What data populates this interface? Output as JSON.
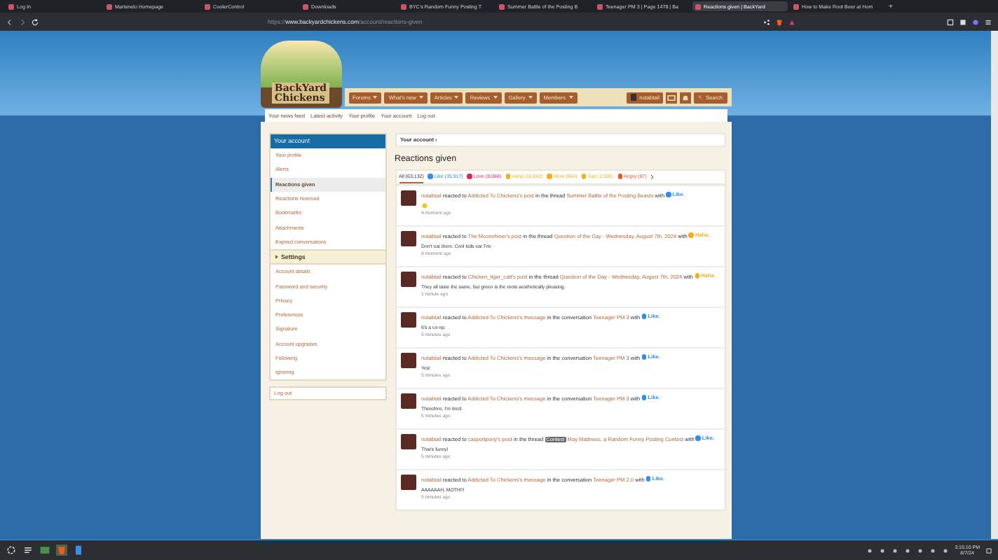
{
  "browser": {
    "tabs": [
      {
        "title": "Log In",
        "selected": false
      },
      {
        "title": "Martenelo Homepage",
        "selected": false
      },
      {
        "title": "CoolerControl",
        "selected": false
      },
      {
        "title": "Downloads",
        "selected": false
      },
      {
        "title": "BYC's Random Funny Posting T",
        "selected": false
      },
      {
        "title": "Summer Battle of the Posting B",
        "selected": false
      },
      {
        "title": "Teenager PM 3 | Page 1478 | Ba",
        "selected": false
      },
      {
        "title": "Reactions given | BackYard",
        "selected": true
      },
      {
        "title": "How to Make Root Beer at Hom",
        "selected": false
      }
    ],
    "new_tab": "+",
    "url_prefix": "https://",
    "url_host": "www.backyardchickens.com",
    "url_path": "/account/reactions-given"
  },
  "header": {
    "logo_line1": "BackYard",
    "logo_line2": "Chickens",
    "nav": [
      "Forums",
      "What's new",
      "Articles",
      "Reviews",
      "Gallery",
      "Members"
    ],
    "user": "notabtail",
    "search": "Search"
  },
  "subnav": [
    "Your news feed",
    "Latest activity",
    "Your profile",
    "Your account",
    "Log out"
  ],
  "sidebar": {
    "title": "Your account",
    "items": [
      {
        "label": "Your profile",
        "selected": false
      },
      {
        "label": "Alerts",
        "selected": false
      },
      {
        "label": "Reactions given",
        "selected": true
      },
      {
        "label": "Reactions received",
        "selected": false
      },
      {
        "label": "Bookmarks",
        "selected": false
      },
      {
        "label": "Attachments",
        "selected": false
      },
      {
        "label": "Expired conversations",
        "selected": false
      }
    ],
    "settings_title": "Settings",
    "settings_items": [
      {
        "label": "Account details",
        "selected": false
      },
      {
        "label": "Password and security",
        "selected": false
      },
      {
        "label": "Privacy",
        "selected": false
      },
      {
        "label": "Preferences",
        "selected": false
      },
      {
        "label": "Signature",
        "selected": false
      },
      {
        "label": "Account upgrades",
        "selected": false
      },
      {
        "label": "Following",
        "selected": false
      },
      {
        "label": "Ignoring",
        "selected": false
      }
    ],
    "logout": "Log out"
  },
  "breadcrumb": "Your account",
  "breadcrumb_caret": "›",
  "title": "Reactions given",
  "filters": [
    {
      "label": "All (63,132)",
      "selected": true
    },
    {
      "label": "Like (35,917)",
      "selected": false,
      "color": "#2f8ef0"
    },
    {
      "label": "Love (8,068)",
      "selected": false,
      "color": "#e0245e"
    },
    {
      "label": "Haha (16,662)",
      "selected": false,
      "color": "#f2b01e"
    },
    {
      "label": "Wow (864)",
      "selected": false,
      "color": "#f2b01e"
    },
    {
      "label": "Sad (1,596)",
      "selected": false,
      "color": "#f2b01e"
    },
    {
      "label": "Angry (87)",
      "selected": false,
      "color": "#e8591a"
    }
  ],
  "feed": [
    {
      "actor": "notabtail",
      "verb": "reacted to",
      "target": "Addicted To Chickens's post",
      "context": "in the thread",
      "thread": "Summer Battle of the Posting Beasts",
      "with": "with",
      "reaction": {
        "kind": "like",
        "label": "Like."
      },
      "emoji_body": true,
      "time": "A moment ago"
    },
    {
      "actor": "notabtail",
      "verb": "reacted to",
      "target": "The Moonshiner's post",
      "context": "in the thread",
      "thread": "Question of the Day - Wednesday, August 7th, 2024",
      "with": "with",
      "reaction": {
        "kind": "haha",
        "label": "Haha."
      },
      "body": "Don't eat them. Cool kids eat Trix",
      "time": "A moment ago"
    },
    {
      "actor": "notabtail",
      "verb": "reacted to",
      "target": "Chicken_tiger_catt's post",
      "context": "in the thread",
      "thread": "Question of the Day - Wednesday, August 7th, 2024",
      "with": "with",
      "reaction": {
        "kind": "haha",
        "label": "Haha."
      },
      "body": "They all taste the same, but green is the most aesthetically pleasing.",
      "time": "1 minute ago"
    },
    {
      "actor": "notabtail",
      "verb": "reacted to",
      "target": "Addicted To Chickens's message",
      "context": "in the conversation",
      "thread": "Teenager PM 3",
      "with": "with",
      "reaction": {
        "kind": "like",
        "label": "Like."
      },
      "body": "It's a co-op.",
      "time": "5 minutes ago"
    },
    {
      "actor": "notabtail",
      "verb": "reacted to",
      "target": "Addicted To Chickens's message",
      "context": "in the conversation",
      "thread": "Teenager PM 3",
      "with": "with",
      "reaction": {
        "kind": "like",
        "label": "Like."
      },
      "body": "Yes!",
      "time": "5 minutes ago"
    },
    {
      "actor": "notabtail",
      "verb": "reacted to",
      "target": "Addicted To Chickens's message",
      "context": "in the conversation",
      "thread": "Teenager PM 3",
      "with": "with",
      "reaction": {
        "kind": "like",
        "label": "Like."
      },
      "body": "Therefore, I'm tired.",
      "time": "5 minutes ago"
    },
    {
      "actor": "notabtail",
      "verb": "reacted to",
      "target": "casportpony's post",
      "context": "in the thread",
      "prefix": "Contest",
      "thread": "May Madness, a Random Funny Posting Contest",
      "with": "with",
      "reaction": {
        "kind": "like",
        "label": "Like."
      },
      "body": "That's funny!",
      "time": "5 minutes ago"
    },
    {
      "actor": "notabtail",
      "verb": "reacted to",
      "target": "Addicted To Chickens's message",
      "context": "in the conversation",
      "thread": "Teenager PM 2.0",
      "with": "with",
      "reaction": {
        "kind": "like",
        "label": "Like."
      },
      "body": "AAAAAAH, MOTH!!!",
      "time": "5 minutes ago"
    }
  ],
  "taskbar": {
    "time": "3:15:10 PM",
    "date": "8/7/24"
  }
}
